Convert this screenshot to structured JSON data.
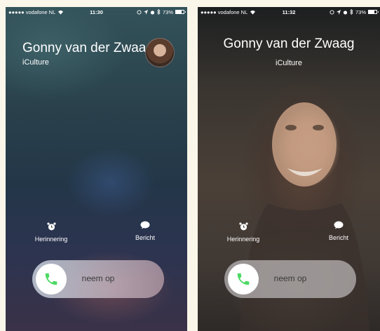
{
  "colors": {
    "accept_green": "#4cd964",
    "background": "#fbf6ea"
  },
  "screens": [
    {
      "status": {
        "carrier": "●●●●● vodafone NL",
        "time": "11:30",
        "battery": "73%"
      },
      "caller": {
        "name": "Gonny van der Zwaag",
        "label": "iCulture"
      },
      "actions": {
        "remind": "Herinnering",
        "message": "Bericht"
      },
      "slider": {
        "label": "neem op"
      }
    },
    {
      "status": {
        "carrier": "●●●●● vodafone NL",
        "time": "11:32",
        "battery": "73%"
      },
      "caller": {
        "name": "Gonny van der Zwaag",
        "label": "iCulture"
      },
      "actions": {
        "remind": "Herinnering",
        "message": "Bericht"
      },
      "slider": {
        "label": "neem op"
      }
    }
  ]
}
